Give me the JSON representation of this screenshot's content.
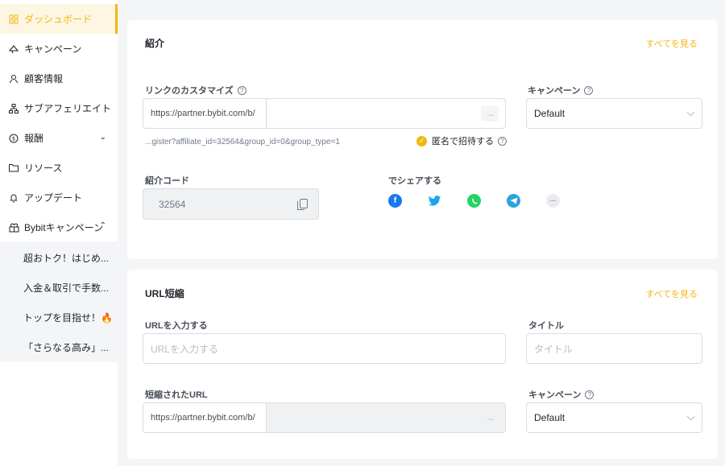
{
  "sidebar": {
    "items": [
      {
        "label": "ダッシュボード",
        "icon": "grid-icon"
      },
      {
        "label": "キャンペーン",
        "icon": "megaphone-icon"
      },
      {
        "label": "顧客情報",
        "icon": "users-icon"
      },
      {
        "label": "サブアフェリエイト",
        "icon": "hierarchy-icon"
      },
      {
        "label": "報酬",
        "icon": "dollar-icon"
      },
      {
        "label": "リソース",
        "icon": "folder-icon"
      },
      {
        "label": "アップデート",
        "icon": "bell-icon"
      },
      {
        "label": "Bybitキャンペーン",
        "icon": "gift-icon"
      }
    ],
    "sub_items": [
      {
        "label": "超おトク！はじめ..."
      },
      {
        "label": "入金＆取引で手数..."
      },
      {
        "label": "トップを目指せ！🔥"
      },
      {
        "label": "「さらなる高み」..."
      }
    ]
  },
  "referral": {
    "title": "紹介",
    "see_all": "すべてを見る",
    "link_label": "リンクのカスタマイズ",
    "url_prefix": "https://partner.bybit.com/b/",
    "url_tail": "...gister?affiliate_id=32564&group_id=0&group_type=1",
    "campaign_label": "キャンペーン",
    "campaign_value": "Default",
    "anonymous_label": "匿名で招待する",
    "code_label": "紹介コード",
    "code_value": "32564",
    "share_label": "でシェアする",
    "share_more": "···"
  },
  "shortener": {
    "title": "URL短縮",
    "see_all": "すべてを見る",
    "url_label": "URLを入力する",
    "url_placeholder": "URLを入力する",
    "title_label": "タイトル",
    "title_placeholder": "タイトル",
    "short_label": "短縮されたURL",
    "short_prefix": "https://partner.bybit.com/b/",
    "campaign_label": "キャンペーン",
    "campaign_value": "Default"
  },
  "colors": {
    "accent": "#f0b90b",
    "facebook": "#1877f2",
    "twitter": "#1da1f2",
    "whatsapp": "#25d366",
    "telegram": "#2aa3de"
  }
}
